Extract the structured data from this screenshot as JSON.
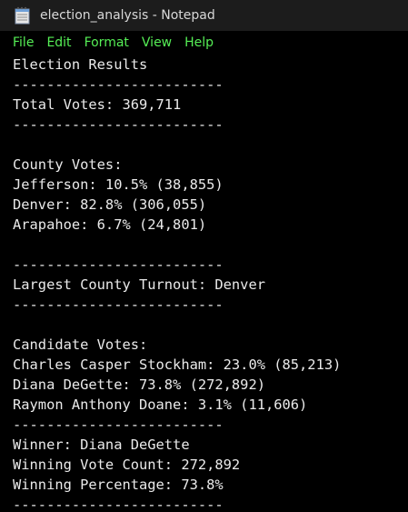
{
  "window": {
    "title": "election_analysis - Notepad",
    "icon": "notepad-icon"
  },
  "menu": {
    "items": [
      "File",
      "Edit",
      "Format",
      "View",
      "Help"
    ]
  },
  "editor": {
    "lines": [
      "Election Results",
      "-------------------------",
      "Total Votes: 369,711",
      "-------------------------",
      "",
      "County Votes:",
      "Jefferson: 10.5% (38,855)",
      "Denver: 82.8% (306,055)",
      "Arapahoe: 6.7% (24,801)",
      "",
      "-------------------------",
      "Largest County Turnout: Denver",
      "-------------------------",
      "",
      "Candidate Votes:",
      "Charles Casper Stockham: 23.0% (85,213)",
      "Diana DeGette: 73.8% (272,892)",
      "Raymon Anthony Doane: 3.1% (11,606)",
      "-------------------------",
      "Winner: Diana DeGette",
      "Winning Vote Count: 272,892",
      "Winning Percentage: 73.8%",
      "-------------------------"
    ]
  },
  "colors": {
    "background": "#000000",
    "text": "#eaeaea",
    "menu_text": "#55ee55",
    "titlebar": "#1c1c1c"
  }
}
